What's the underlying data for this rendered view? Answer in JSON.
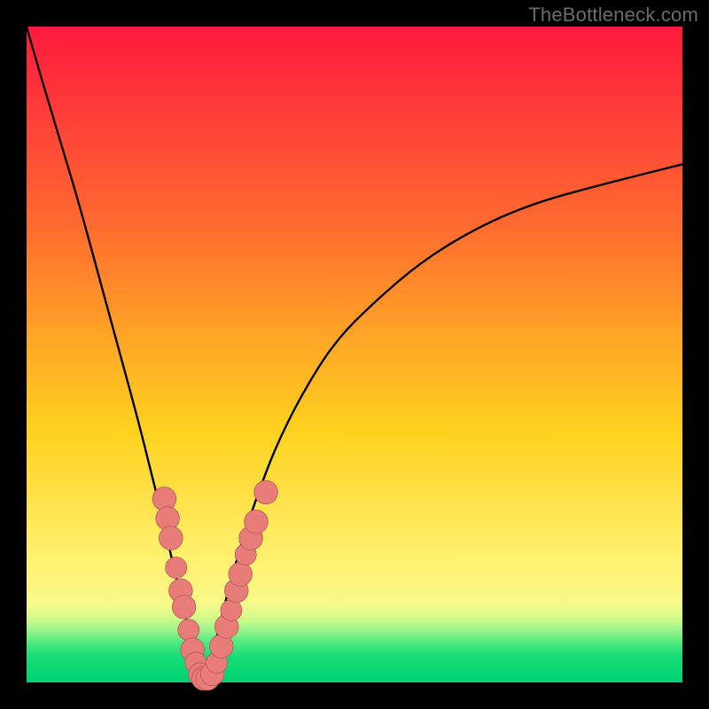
{
  "watermark": "TheBottleneck.com",
  "colors": {
    "frame": "#000000",
    "curve": "#000000",
    "marker_fill": "#e87c78",
    "marker_stroke": "#b85a56"
  },
  "chart_data": {
    "type": "line",
    "title": "",
    "xlabel": "",
    "ylabel": "",
    "xlim": [
      0,
      100
    ],
    "ylim": [
      0,
      100
    ],
    "note": "V-shaped bottleneck curve. y ≈ 100 at x≈0, drops to 0 near x≈27, rises asymptotically toward ~80 at x=100. Values estimated from pixel positions (no axis ticks shown).",
    "x": [
      0,
      2,
      5,
      8,
      11,
      14,
      17,
      19,
      21,
      23,
      24,
      25,
      26,
      27,
      28,
      29,
      30,
      31,
      33,
      35,
      38,
      42,
      47,
      53,
      60,
      68,
      77,
      88,
      100
    ],
    "y": [
      100,
      93,
      83,
      73,
      62,
      51,
      40,
      32,
      24,
      15,
      11,
      7,
      3,
      0,
      3,
      7,
      11,
      15,
      22,
      28,
      36,
      44,
      52,
      58,
      64,
      69,
      73,
      76,
      79
    ],
    "markers": {
      "comment": "pink bead markers clustered on the lower arms of the V",
      "points": [
        {
          "x": 21.0,
          "y": 28.0,
          "r": 1.4
        },
        {
          "x": 21.5,
          "y": 25.0,
          "r": 1.4
        },
        {
          "x": 22.0,
          "y": 22.0,
          "r": 1.4
        },
        {
          "x": 22.8,
          "y": 17.5,
          "r": 1.2
        },
        {
          "x": 23.5,
          "y": 14.0,
          "r": 1.4
        },
        {
          "x": 24.0,
          "y": 11.5,
          "r": 1.4
        },
        {
          "x": 24.7,
          "y": 8.0,
          "r": 1.2
        },
        {
          "x": 25.3,
          "y": 5.0,
          "r": 1.4
        },
        {
          "x": 25.8,
          "y": 3.0,
          "r": 1.2
        },
        {
          "x": 26.5,
          "y": 1.2,
          "r": 1.4
        },
        {
          "x": 27.0,
          "y": 0.6,
          "r": 1.4
        },
        {
          "x": 27.6,
          "y": 0.6,
          "r": 1.4
        },
        {
          "x": 28.3,
          "y": 1.3,
          "r": 1.4
        },
        {
          "x": 29.0,
          "y": 3.0,
          "r": 1.2
        },
        {
          "x": 29.7,
          "y": 5.5,
          "r": 1.4
        },
        {
          "x": 30.5,
          "y": 8.5,
          "r": 1.4
        },
        {
          "x": 31.2,
          "y": 11.0,
          "r": 1.2
        },
        {
          "x": 32.0,
          "y": 14.0,
          "r": 1.4
        },
        {
          "x": 32.6,
          "y": 16.5,
          "r": 1.4
        },
        {
          "x": 33.4,
          "y": 19.5,
          "r": 1.2
        },
        {
          "x": 34.2,
          "y": 22.0,
          "r": 1.4
        },
        {
          "x": 35.0,
          "y": 24.5,
          "r": 1.4
        },
        {
          "x": 36.5,
          "y": 29.0,
          "r": 1.4
        }
      ]
    }
  }
}
